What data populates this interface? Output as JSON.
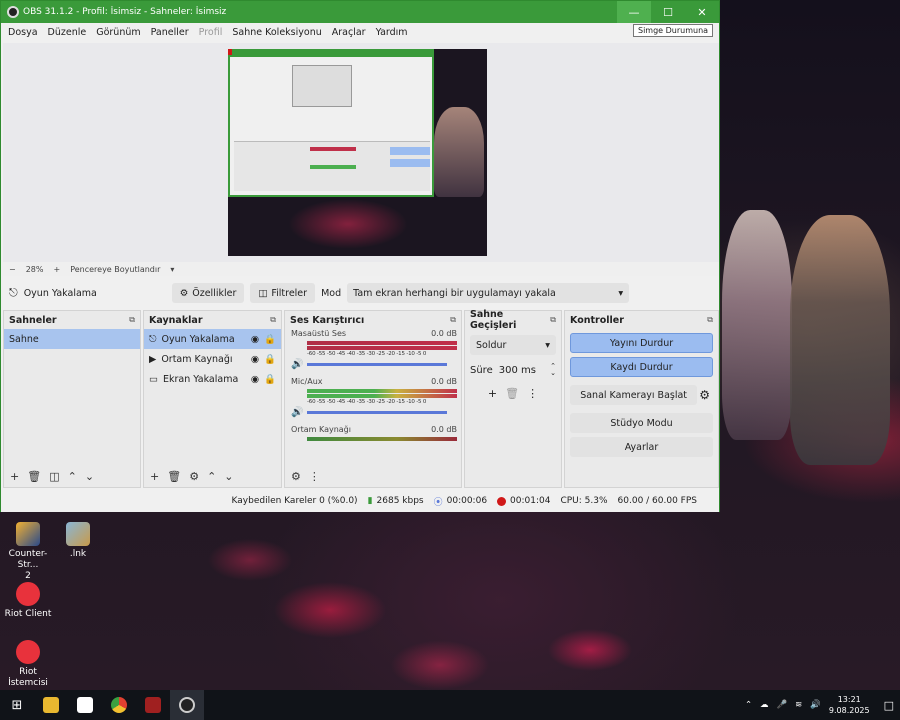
{
  "window": {
    "title": "OBS 31.1.2 - Profil: İsimsiz - Sahneler: İsimsiz",
    "tooltip": "Simge Durumuna"
  },
  "menu": [
    "Dosya",
    "Düzenle",
    "Görünüm",
    "Paneller",
    "Profil",
    "Sahne Koleksiyonu",
    "Araçlar",
    "Yardım"
  ],
  "zoom": {
    "minus": "−",
    "value": "28%",
    "plus": "+",
    "fit_label": "Pencereye Boyutlandır"
  },
  "source_bar": {
    "source_name": "Oyun Yakalama",
    "properties": "Özellikler",
    "filters": "Filtreler",
    "mode_label": "Mod",
    "mode_value": "Tam ekran herhangi bir uygulamayı yakala"
  },
  "scenes": {
    "title": "Sahneler",
    "items": [
      "Sahne"
    ]
  },
  "sources": {
    "title": "Kaynaklar",
    "items": [
      "Oyun Yakalama",
      "Ortam Kaynağı",
      "Ekran Yakalama"
    ]
  },
  "mixer": {
    "title": "Ses Karıştırıcı",
    "channels": [
      {
        "name": "Masaüstü Ses",
        "db": "0.0 dB"
      },
      {
        "name": "Mic/Aux",
        "db": "0.0 dB"
      },
      {
        "name": "Ortam Kaynağı",
        "db": "0.0 dB"
      }
    ],
    "scale": "-60 -55 -50 -45 -40 -35 -30 -25 -20 -15 -10 -5 0"
  },
  "transitions": {
    "title": "Sahne Geçişleri",
    "type": "Soldur",
    "duration_label": "Süre",
    "duration_value": "300 ms"
  },
  "controls": {
    "title": "Kontroller",
    "stop_stream": "Yayını Durdur",
    "stop_record": "Kaydı Durdur",
    "virtual_cam": "Sanal Kamerayı Başlat",
    "studio_mode": "Stüdyo Modu",
    "settings": "Ayarlar"
  },
  "status": {
    "dropped": "Kaybedilen Kareler 0 (%0.0)",
    "bitrate": "2685 kbps",
    "stream_time": "00:00:06",
    "record_time": "00:01:04",
    "cpu": "CPU: 5.3%",
    "fps": "60.00 / 60.00 FPS"
  },
  "desktop_icons": [
    {
      "label": "Counter-Strike 2",
      "line1": "Counter-Str...",
      "line2": "2"
    },
    {
      "label": ".lnk",
      "line1": ".lnk",
      "line2": ""
    },
    {
      "label": "Riot Client",
      "line1": "Riot Client",
      "line2": ""
    },
    {
      "label": "Riot İstemcisi",
      "line1": "Riot İstemcisi",
      "line2": ""
    }
  ],
  "taskbar": {
    "time": "13:21",
    "date": "9.08.2025"
  },
  "colors": {
    "titlebar": "#3a9a3a",
    "selection": "#a8c4ee",
    "active_button": "#9bbcf0",
    "record_dot": "#d01818",
    "meter_green": "#4caf50",
    "meter_red": "#c0304a"
  }
}
